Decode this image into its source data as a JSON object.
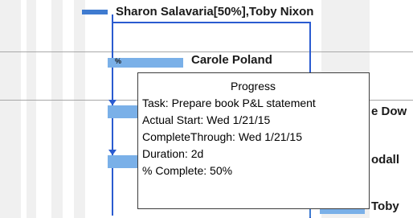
{
  "gantt": {
    "summary_task": {
      "resource_label": "Sharon Salavaria[50%],Toby Nixon"
    },
    "tasks": [
      {
        "resource_label": "Carole Poland",
        "progress_icon": "%"
      },
      {
        "resource_label": "e Dow"
      },
      {
        "resource_label": "odall"
      },
      {
        "resource_label": "Toby"
      }
    ]
  },
  "tooltip": {
    "title": "Progress",
    "lines": [
      "Task: Prepare book P&L statement",
      "Actual Start: Wed 1/21/15",
      "CompleteThrough: Wed 1/21/15",
      "Duration: 2d",
      "% Complete: 50%"
    ]
  },
  "colors": {
    "task_bar": "#7ab0e8",
    "summary_bar": "#3f7bd0",
    "dependency_line": "#2a5bd0",
    "nonworking_shade": "#f0f0f0"
  }
}
